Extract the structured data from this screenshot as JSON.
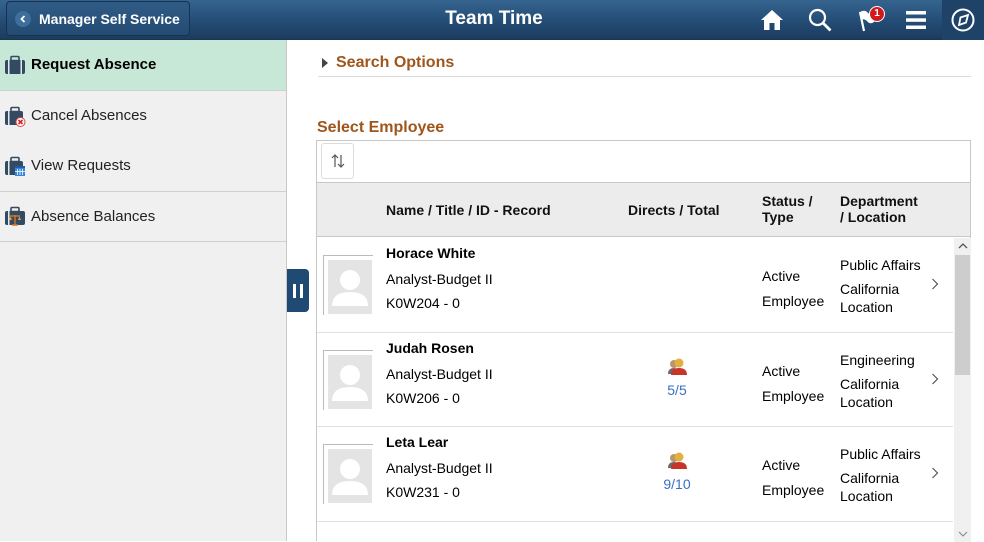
{
  "header": {
    "back_label": "Manager Self Service",
    "title": "Team Time",
    "notification_count": "1",
    "icons": [
      "home-icon",
      "search-icon",
      "notifications-flag-icon",
      "menu-icon",
      "navbar-compass-icon"
    ]
  },
  "sidebar": {
    "items": [
      {
        "label": "Request Absence",
        "icon": "briefcase-icon",
        "active": true
      },
      {
        "label": "Cancel Absences",
        "icon": "briefcase-cancel-icon",
        "active": false
      },
      {
        "label": "View Requests",
        "icon": "briefcase-calendar-icon",
        "active": false
      },
      {
        "label": "Absence Balances",
        "icon": "briefcase-scale-icon",
        "active": false
      }
    ]
  },
  "main": {
    "search_options_label": "Search Options",
    "select_employee_label": "Select Employee",
    "columns": {
      "name": "Name / Title / ID - Record",
      "directs": "Directs / Total",
      "status_1": "Status /",
      "status_2": "Type",
      "dept_1": "Department",
      "dept_2": "/ Location"
    },
    "employees": [
      {
        "name": "Horace White",
        "title": "Analyst-Budget II",
        "id": "K0W204 - 0",
        "directs": "",
        "status": "Active",
        "type": "Employee",
        "department": "Public Affairs",
        "location_1": "California",
        "location_2": "Location"
      },
      {
        "name": "Judah Rosen",
        "title": "Analyst-Budget II",
        "id": "K0W206 - 0",
        "directs": "5/5",
        "status": "Active",
        "type": "Employee",
        "department": "Engineering",
        "location_1": "California",
        "location_2": "Location"
      },
      {
        "name": "Leta Lear",
        "title": "Analyst-Budget II",
        "id": "K0W231 - 0",
        "directs": "9/10",
        "status": "Active",
        "type": "Employee",
        "department": "Public Affairs",
        "location_1": "California",
        "location_2": "Location"
      }
    ]
  },
  "colors": {
    "header_bg": "#234a72",
    "active_item_bg": "#c7e8d7",
    "section_title": "#a0551a",
    "link_blue": "#3a6fc4",
    "badge_red": "#d0181e"
  }
}
